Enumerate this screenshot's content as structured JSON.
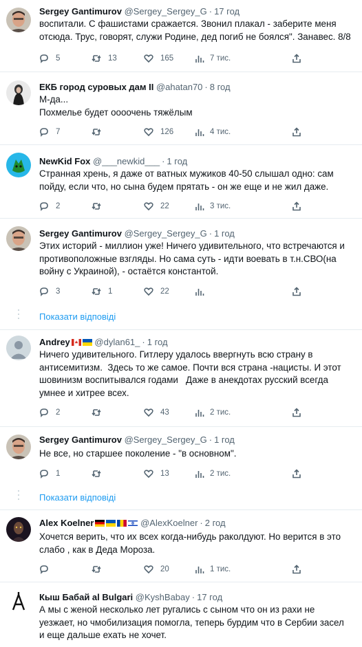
{
  "tweets": [
    {
      "name": "Sergey Gantimurov",
      "handle": "@Sergey_Sergey_G",
      "time": "17 год",
      "lines": [
        "воспитали. С фашистами сражается. Звонил плакал - заберите меня",
        "отсюда. Трус, говорят, служи Родине, дед погиб не боялся\". Занавес. 8/8"
      ],
      "replies": "5",
      "retweets": "13",
      "likes": "",
      "views": "165",
      "views_label": "7 тис.",
      "avatar": "man"
    },
    {
      "name": "ЕКБ город суровых дам II",
      "handle": "@ahatan70",
      "time": "8 год",
      "lines": [
        "М-да...",
        "Похмелье будет оооочень тяжёлым"
      ],
      "replies": "7",
      "retweets": "",
      "likes": "126",
      "views_label": "4 тис.",
      "avatar": "woman"
    },
    {
      "name": "NewKid Fox",
      "handle": "@___newkid___",
      "time": "1 год",
      "lines": [
        "Странная хрень, я даже от ватных мужиков 40-50 слышал одно: сам",
        "пойду, если что, но сына будем прятать - он же еще и не жил даже."
      ],
      "replies": "2",
      "retweets": "",
      "likes": "22",
      "views_label": "3 тис.",
      "avatar": "fox"
    },
    {
      "name": "Sergey Gantimurov",
      "handle": "@Sergey_Sergey_G",
      "time": "1 год",
      "lines": [
        "Этих историй - миллион уже! Ничего удивительного, что встречаются и",
        "противоположные взгляды. Но сама суть - идти воевать в т.н.СВО(на",
        "войну с Украиной), - остаётся константой."
      ],
      "replies": "3",
      "retweets": "1",
      "likes": "22",
      "views_label": "",
      "avatar": "man"
    },
    {
      "name": "Andrey",
      "handle": "@dylan61_",
      "time": "1 год",
      "lines": [
        "Ничего удивительного. Гитлеру удалось ввергнуть всю страну в",
        "антисемитизм.  Здесь то же самое. Почти вся страна -нацисты. И этот",
        "шовинизм воспитывался годами   Даже в анекдотах русский всегда",
        "умнее и хитрее всех."
      ],
      "replies": "2",
      "retweets": "",
      "likes": "43",
      "views_label": "2 тис.",
      "avatar": "default"
    },
    {
      "name": "Sergey Gantimurov",
      "handle": "@Sergey_Sergey_G",
      "time": "1 год",
      "lines": [
        "Не все, но старшее поколение - \"в основном\"."
      ],
      "replies": "1",
      "retweets": "",
      "likes": "13",
      "views_label": "2 тис.",
      "avatar": "man"
    },
    {
      "name": "Alex Koelner",
      "handle": "@AlexKoelner",
      "time": "2 год",
      "lines": [
        "Хочется верить, что их всех когда-нибудь раколдуют. Но верится в это",
        "слабо , как в Деда Мороза."
      ],
      "replies": "",
      "retweets": "",
      "likes": "20",
      "views_label": "1 тис.",
      "avatar": "dark"
    },
    {
      "name": "Кыш Бабай al Bulgari",
      "handle": "@KyshBabay",
      "time": "17 год",
      "lines": [
        "А мы с женой несколько лет ругались с сыном что он из рахи не",
        "уезжает, но чмобилизация помогла, теперь бурдим что в Сербии засел",
        "и еще дальше ехать не хочет."
      ],
      "avatar": "logo"
    }
  ],
  "show_replies_label": "Показати відповіді",
  "colors": {
    "link": "#1d9bf0",
    "secondary": "#536471",
    "divider": "#e6ecf0",
    "thread": "#cfd9de"
  }
}
